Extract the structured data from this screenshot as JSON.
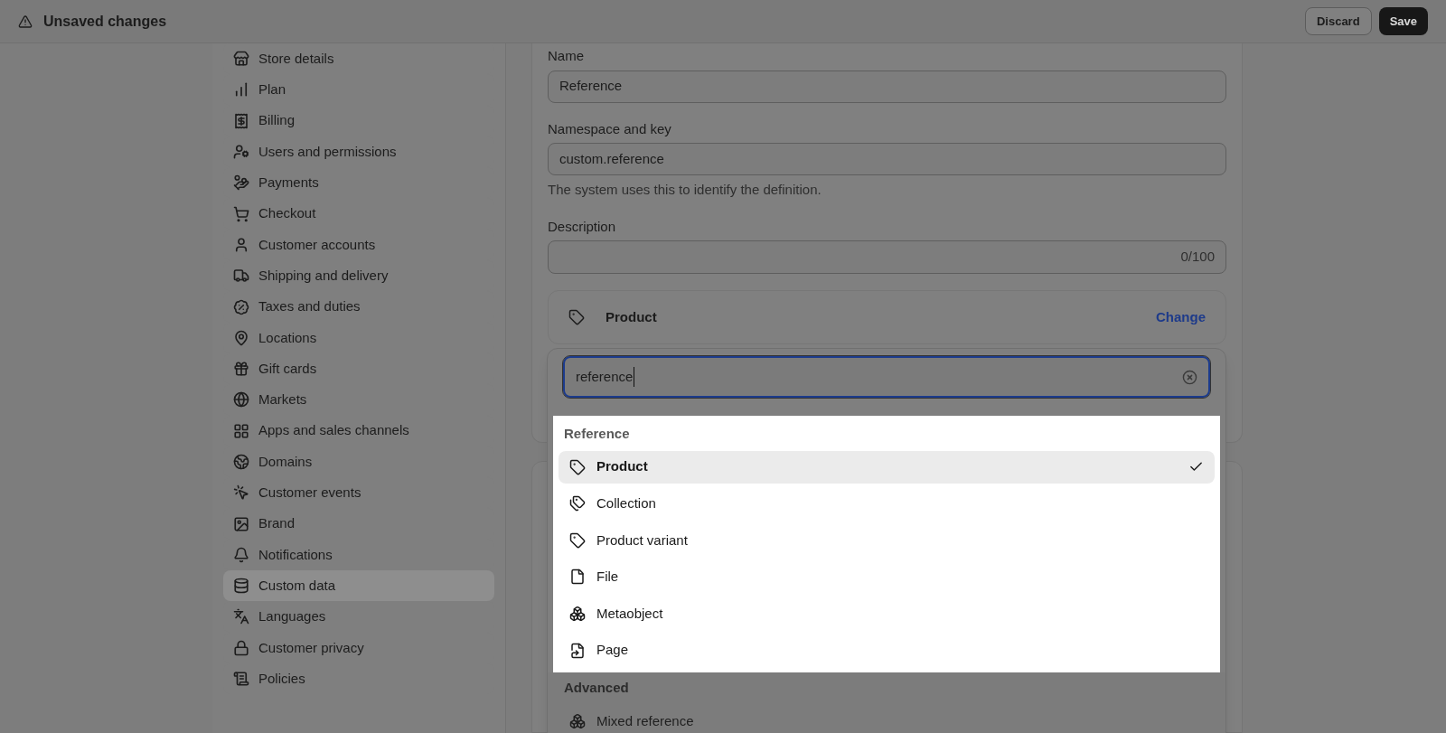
{
  "header": {
    "title": "Unsaved changes",
    "buttons": [
      {
        "label": "Discard",
        "kind": "secondary"
      },
      {
        "label": "Save",
        "kind": "primary"
      }
    ]
  },
  "sidebar": {
    "items": [
      {
        "label": "Store details",
        "selected": false
      },
      {
        "label": "Plan",
        "selected": false
      },
      {
        "label": "Billing",
        "selected": false
      },
      {
        "label": "Users and permissions",
        "selected": false
      },
      {
        "label": "Payments",
        "selected": false
      },
      {
        "label": "Checkout",
        "selected": false
      },
      {
        "label": "Customer accounts",
        "selected": false
      },
      {
        "label": "Shipping and delivery",
        "selected": false
      },
      {
        "label": "Taxes and duties",
        "selected": false
      },
      {
        "label": "Locations",
        "selected": false
      },
      {
        "label": "Gift cards",
        "selected": false
      },
      {
        "label": "Markets",
        "selected": false
      },
      {
        "label": "Apps and sales channels",
        "selected": false
      },
      {
        "label": "Domains",
        "selected": false
      },
      {
        "label": "Customer events",
        "selected": false
      },
      {
        "label": "Brand",
        "selected": false
      },
      {
        "label": "Notifications",
        "selected": false
      },
      {
        "label": "Custom data",
        "selected": true
      },
      {
        "label": "Languages",
        "selected": false
      },
      {
        "label": "Customer privacy",
        "selected": false
      },
      {
        "label": "Policies",
        "selected": false
      }
    ]
  },
  "form": {
    "name": {
      "label": "Name",
      "value": "Reference"
    },
    "namespace": {
      "label": "Namespace and key",
      "value": "custom.reference",
      "help": "The system uses this to identify the definition."
    },
    "description": {
      "label": "Description",
      "counter": "0/100"
    },
    "type": {
      "label": "Product",
      "action": "Change"
    },
    "type_picker": {
      "search": "reference",
      "groups": [
        {
          "title": "Reference",
          "highlighted": true,
          "options": [
            {
              "label": "Product",
              "selected": true
            },
            {
              "label": "Collection",
              "selected": false
            },
            {
              "label": "Product variant",
              "selected": false
            },
            {
              "label": "File",
              "selected": false
            },
            {
              "label": "Metaobject",
              "selected": false
            },
            {
              "label": "Page",
              "selected": false
            }
          ]
        },
        {
          "title": "Advanced",
          "highlighted": false,
          "options": [
            {
              "label": "Mixed reference",
              "selected": false
            }
          ]
        }
      ]
    }
  }
}
